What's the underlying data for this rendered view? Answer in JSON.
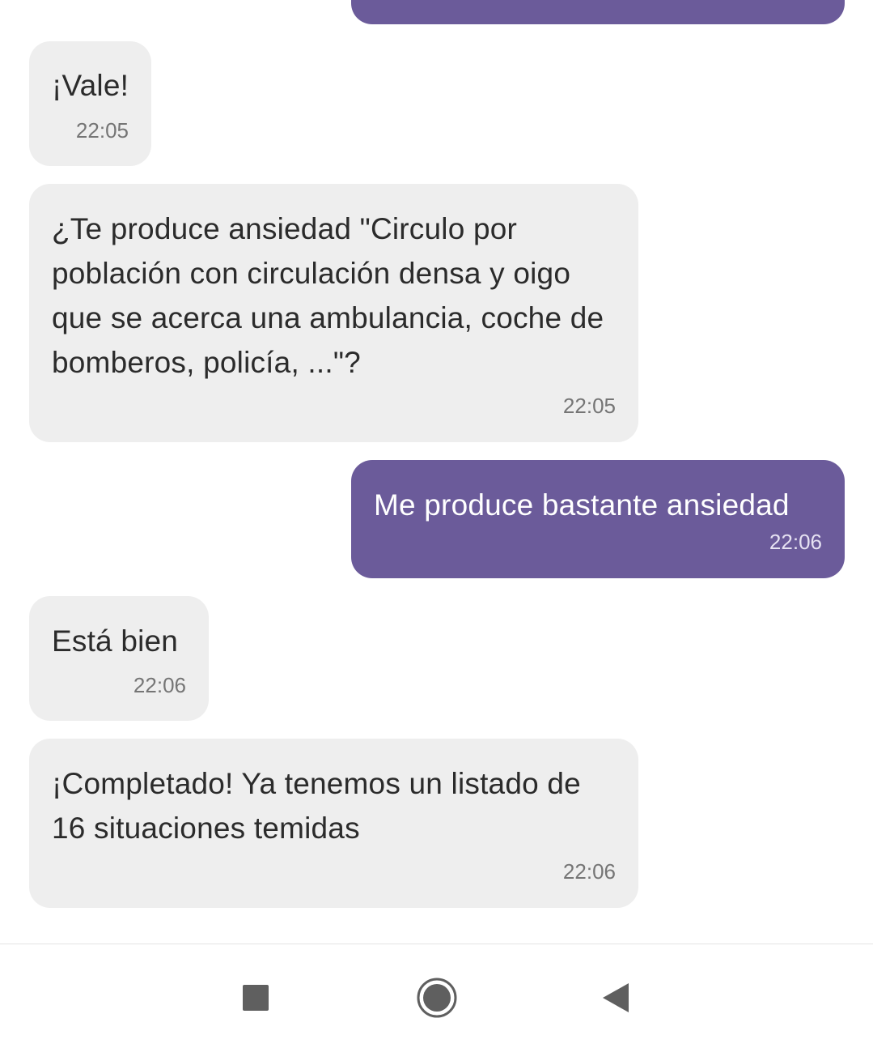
{
  "messages": [
    {
      "id": "m0",
      "direction": "outgoing",
      "text": "",
      "time": ""
    },
    {
      "id": "m1",
      "direction": "incoming",
      "text": "¡Vale!",
      "time": "22:05"
    },
    {
      "id": "m2",
      "direction": "incoming",
      "text": "¿Te produce ansiedad \"Circulo por población con circulación densa y oigo que se acerca una ambulancia, coche de bomberos, policía, ...\"?",
      "time": "22:05"
    },
    {
      "id": "m3",
      "direction": "outgoing",
      "text": "Me produce bastante ansiedad",
      "time": "22:06"
    },
    {
      "id": "m4",
      "direction": "incoming",
      "text": "Está bien",
      "time": "22:06"
    },
    {
      "id": "m5",
      "direction": "incoming",
      "text": "¡Completado! Ya tenemos un listado de 16 situaciones temidas",
      "time": "22:06"
    }
  ],
  "navigation": {
    "recents_icon": "square-recents-icon",
    "home_icon": "circle-home-icon",
    "back_icon": "triangle-back-icon"
  },
  "colors": {
    "outgoing_bubble": "#6b5b9a",
    "incoming_bubble": "#eeeeee",
    "nav_icons": "#5f5f5f"
  }
}
